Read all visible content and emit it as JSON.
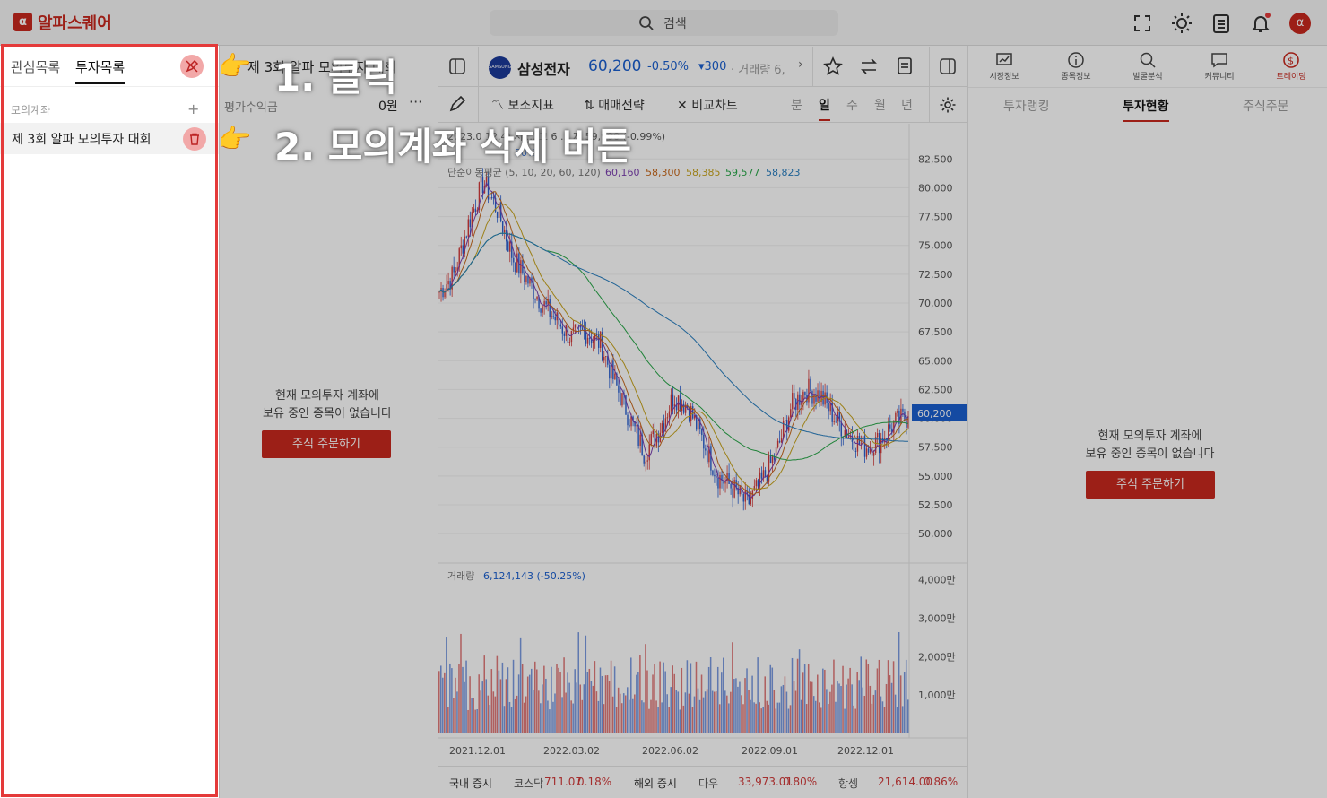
{
  "app": {
    "brand": "알파스퀘어",
    "search_placeholder": "검색"
  },
  "left": {
    "tabs": [
      "관심목록",
      "투자목록"
    ],
    "section_label": "모의계좌",
    "add_label": "+",
    "account": "제 3회 알파 모의투자 대회"
  },
  "portfolio": {
    "title": "제 3회 알파 모의투자 대회",
    "pl_label": "평가수익금",
    "pl_value": "0원",
    "more": "···",
    "empty_line1": "현재 모의투자 계좌에",
    "empty_line2": "보유 중인 종목이 없습니다",
    "order_button": "주식 주문하기"
  },
  "stock": {
    "logo": "SAMSUNG",
    "name": "삼성전자",
    "price": "60,200",
    "change": "-0.50%",
    "diff": "▾300",
    "volume": "· 거래량 6,"
  },
  "tools": {
    "indicator": "보조지표",
    "strategy": "매매전략",
    "compare": "비교차트"
  },
  "periods": [
    "분",
    "일",
    "주",
    "월",
    "년"
  ],
  "chart_text": {
    "info_line": "2023.0 12.4) 시 ... 고 6 ... 저 59,900 (-0.99%)",
    "sub_line": "50%",
    "ma_label": "단순이동평균 (5, 10, 20, 60, 120)",
    "ma_values": [
      "60,160",
      "58,300",
      "58,385",
      "59,577",
      "58,823"
    ],
    "ma_colors": [
      "#7b3fb0",
      "#c86a1e",
      "#c8a41e",
      "#2aa84a",
      "#2a7fc0"
    ],
    "volume_label": "거래량",
    "volume_value": "6,124,143 (-50.25%)",
    "current_price_tag": "60,200"
  },
  "chart_data": {
    "type": "candlestick",
    "price_axis": [
      "82,500",
      "80,000",
      "77,500",
      "75,000",
      "72,500",
      "70,000",
      "67,500",
      "65,000",
      "62,500",
      "60,000",
      "57,500",
      "55,000",
      "52,500",
      "50,000"
    ],
    "price_ylim": [
      49000,
      84000
    ],
    "volume_axis": [
      "4,000만",
      "3,000만",
      "2,000만",
      "1,000만"
    ],
    "volume_ylim": [
      0,
      42000000
    ],
    "x_labels": [
      "2021.12.01",
      "2022.03.02",
      "2022.06.02",
      "2022.09.01",
      "2022.12.01"
    ],
    "close_path": [
      71000,
      72500,
      77000,
      80500,
      78000,
      74000,
      72000,
      70000,
      68500,
      67000,
      67500,
      66500,
      63000,
      60000,
      57000,
      59000,
      62000,
      61000,
      58000,
      55000,
      54000,
      52500,
      54500,
      57000,
      61000,
      62500,
      62000,
      60000,
      58500,
      57500,
      58000,
      59500,
      60200
    ],
    "current_price": 60200
  },
  "market": {
    "domestic_label": "국내 증시",
    "kosdaq_label": "코스닥",
    "kosdaq_value": "711.07",
    "kosdaq_change": "0.18%",
    "overseas_label": "해외 증시",
    "dow_label": "다우",
    "dow_value": "33,973.01",
    "dow_change": "0.80%",
    "hangseng_label": "항셍",
    "hangseng_value": "21,614.00",
    "hangseng_change": "0.86%"
  },
  "right_nav": [
    "시장정보",
    "종목정보",
    "발굴분석",
    "커뮤니티",
    "트레이딩"
  ],
  "right_tabs": [
    "투자랭킹",
    "투자현황",
    "주식주문"
  ],
  "right": {
    "empty_line1": "현재 모의투자 계좌에",
    "empty_line2": "보유 중인 종목이 없습니다",
    "order_button": "주식 주문하기"
  },
  "annotations": {
    "step1": "1. 클릭",
    "step2": "2. 모의계좌 삭제 버튼"
  },
  "colors": {
    "accent": "#c8281e",
    "up": "#d23c3c",
    "down": "#1a5fd0",
    "highlight": "#e43a3a"
  }
}
